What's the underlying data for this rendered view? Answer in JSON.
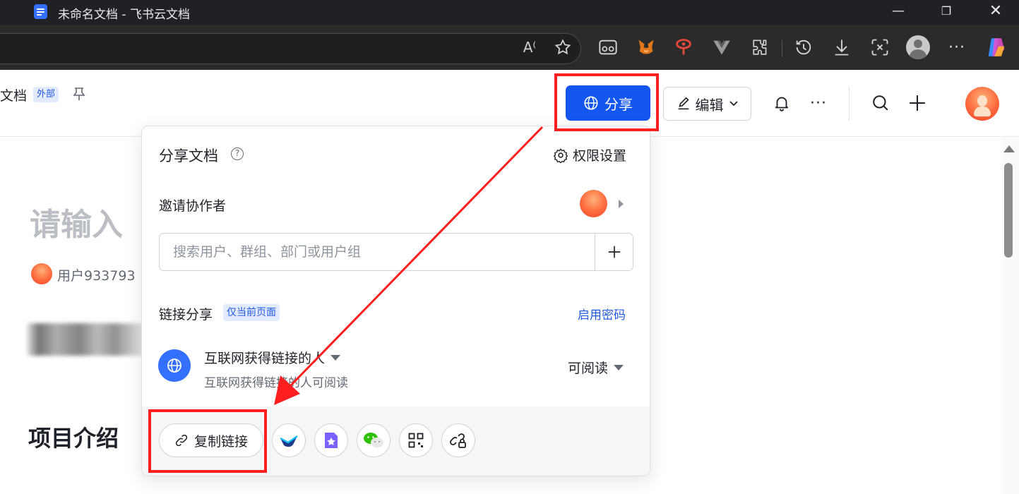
{
  "browser": {
    "tab_title": "未命名文档 - 飞书云文档",
    "window_controls": [
      "minimize",
      "restore",
      "close"
    ],
    "toolbar_icons": [
      "read-aloud-icon",
      "favorite-star-icon",
      "extension-glasses-icon",
      "metamask-fox-icon",
      "extension-pin-icon",
      "vue-devtools-icon",
      "extensions-puzzle-icon",
      "history-icon",
      "downloads-icon",
      "screenshot-icon",
      "profile-avatar",
      "more-menu-icon",
      "copilot-icon"
    ]
  },
  "header": {
    "doc_crumb": "文档",
    "external_tag": "外部",
    "share_label": "分享",
    "edit_label": "编辑"
  },
  "document": {
    "title_placeholder": "请输入",
    "author": "用户933793",
    "section_heading": "项目介绍"
  },
  "share_panel": {
    "title": "分享文档",
    "permission_settings": "权限设置",
    "invite_label": "邀请协作者",
    "search_placeholder": "搜索用户、群组、部门或用户组",
    "link_share_label": "链接分享",
    "current_page_tag": "仅当前页面",
    "enable_password": "启用密码",
    "link_scope_title": "互联网获得链接的人",
    "link_scope_desc": "互联网获得链接的人可阅读",
    "permission_level": "可阅读",
    "copy_link": "复制链接",
    "share_targets": [
      "lark-messenger-icon",
      "bookmark-doc-icon",
      "wechat-icon",
      "qr-code-icon",
      "link-lock-icon"
    ]
  },
  "colors": {
    "primary": "#1456f0",
    "annotation_red": "#ff1f1f",
    "tag_bg": "#e1eaff"
  }
}
